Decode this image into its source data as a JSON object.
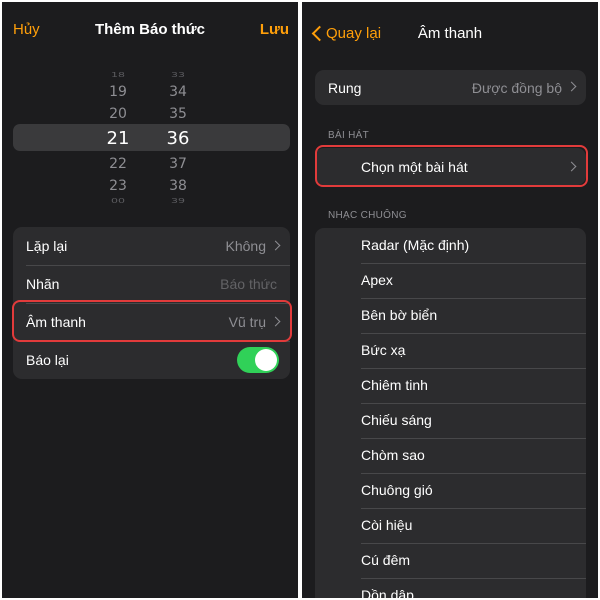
{
  "left": {
    "cancel_label": "Hủy",
    "title": "Thêm Báo thức",
    "save_label": "Lưu",
    "picker": {
      "hours": [
        "18",
        "19",
        "20",
        "21",
        "22",
        "23",
        "00"
      ],
      "minutes": [
        "33",
        "34",
        "35",
        "36",
        "37",
        "38",
        "39"
      ],
      "selected_hour": "21",
      "selected_minute": "36"
    },
    "settings": {
      "repeat": {
        "label": "Lặp lại",
        "value": "Không"
      },
      "label": {
        "label": "Nhãn",
        "placeholder": "Báo thức"
      },
      "sound": {
        "label": "Âm thanh",
        "value": "Vũ trụ"
      },
      "snooze": {
        "label": "Báo lại",
        "on": true
      }
    }
  },
  "right": {
    "back_label": "Quay lại",
    "title": "Âm thanh",
    "vibration": {
      "label": "Rung",
      "value": "Được đồng bộ"
    },
    "songs_header": "BÀI HÁT",
    "pick_song_label": "Chọn một bài hát",
    "ringtones_header": "NHẠC CHUÔNG",
    "ringtones": [
      "Radar (Mặc định)",
      "Apex",
      "Bên bờ biển",
      "Bức xạ",
      "Chiêm tinh",
      "Chiếu sáng",
      "Chòm sao",
      "Chuông gió",
      "Còi hiệu",
      "Cú đêm",
      "Dồn dập"
    ]
  },
  "colors": {
    "accent": "#ff9f0a",
    "background": "#1c1c1e",
    "cell": "#2c2c2e",
    "toggle_on": "#30d158",
    "highlight_border": "#e23b3b"
  }
}
